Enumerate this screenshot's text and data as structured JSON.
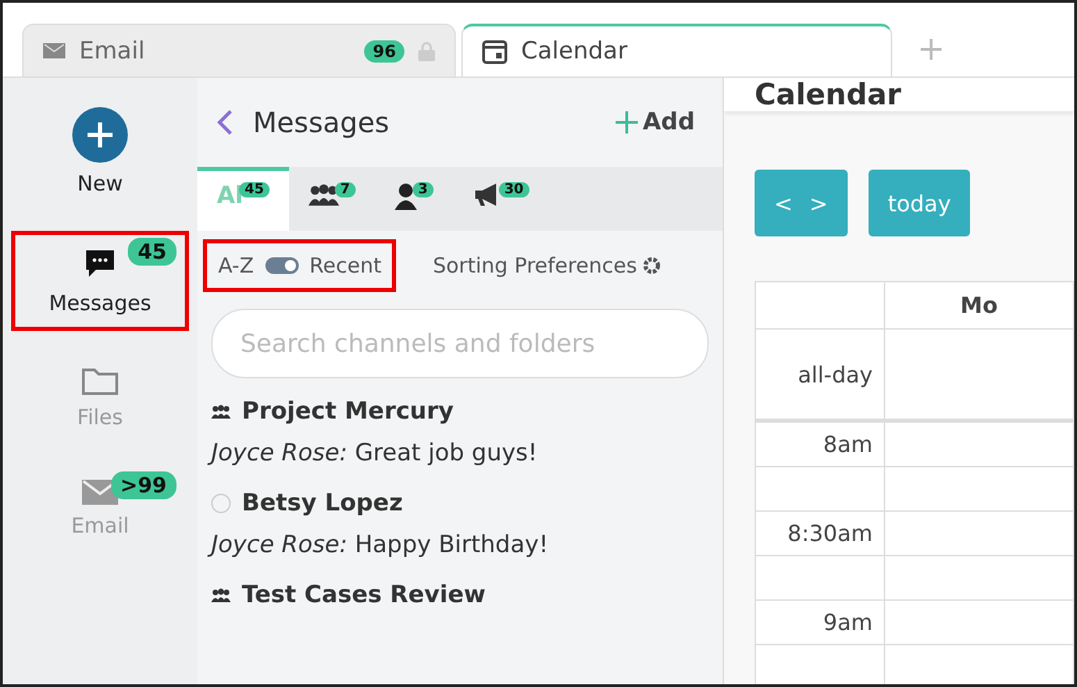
{
  "tabs": [
    {
      "kind": "email",
      "label": "Email",
      "badge": "96",
      "locked": true,
      "selected": false
    },
    {
      "kind": "calendar",
      "label": "Calendar",
      "selected": true
    }
  ],
  "new_tab": "+",
  "rail": [
    {
      "kind": "new",
      "label": "New",
      "highlighted": false
    },
    {
      "kind": "messages",
      "label": "Messages",
      "badge": "45",
      "highlighted": true
    },
    {
      "kind": "files",
      "label": "Files",
      "highlighted": false
    },
    {
      "kind": "email",
      "label": "Email",
      "badge": ">99",
      "highlighted": false
    }
  ],
  "messages": {
    "title": "Messages",
    "add": "Add",
    "filters": [
      {
        "kind": "text",
        "label": "Al",
        "badge": "45",
        "selected": true
      },
      {
        "kind": "group",
        "badge": "7",
        "selected": false
      },
      {
        "kind": "person",
        "badge": "3",
        "selected": false
      },
      {
        "kind": "megaphone",
        "badge": "30",
        "selected": false
      }
    ],
    "sort": {
      "left": "A-Z",
      "right": "Recent",
      "on": true,
      "highlighted": true
    },
    "sorting_preferences": "Sorting Preferences",
    "search": {
      "placeholder": "Search channels and folders"
    },
    "conversations": [
      {
        "kind": "group",
        "name": "Project Mercury",
        "sender": "Joyce Rose:",
        "text": "Great job guys!"
      },
      {
        "kind": "person",
        "name": "Betsy Lopez",
        "sender": "Joyce Rose:",
        "text": "Happy Birthday!"
      },
      {
        "kind": "group",
        "name": "Test Cases Review"
      }
    ]
  },
  "calendar": {
    "title": "Calendar",
    "prev": "<",
    "next": ">",
    "today": "today",
    "column_header": "Mo",
    "rows": [
      {
        "kind": "allday",
        "label": "all-day"
      },
      {
        "kind": "slot",
        "label": "8am"
      },
      {
        "kind": "slot"
      },
      {
        "kind": "slot",
        "label": "8:30am"
      },
      {
        "kind": "slot"
      },
      {
        "kind": "slot",
        "label": "9am"
      },
      {
        "kind": "slot"
      }
    ]
  }
}
